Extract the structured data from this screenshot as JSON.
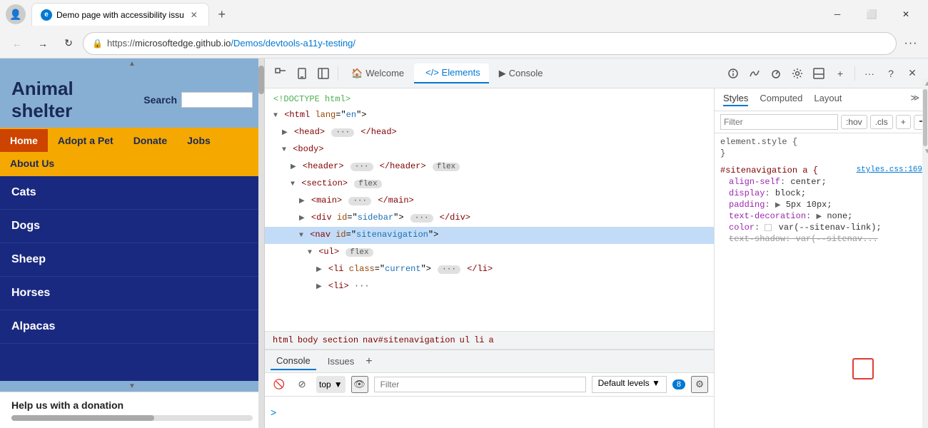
{
  "browser": {
    "tab_title": "Demo page with accessibility issu",
    "url_display": "https://microsoftedge.github.io/Demos/devtools-a11y-testing/",
    "url_scheme": "https://",
    "url_host": "microsoftedge.github.io",
    "url_path": "/Demos/devtools-a11y-testing/"
  },
  "website": {
    "title_line1": "Animal",
    "title_line2": "shelter",
    "search_label": "Search",
    "nav_items": [
      {
        "label": "Home",
        "active": true
      },
      {
        "label": "Adopt a Pet",
        "active": false
      },
      {
        "label": "Donate",
        "active": false
      },
      {
        "label": "Jobs",
        "active": false
      },
      {
        "label": "About Us",
        "active": false
      }
    ],
    "animal_list": [
      "Cats",
      "Dogs",
      "Sheep",
      "Horses",
      "Alpacas"
    ],
    "footer_text": "Help us with a donation"
  },
  "devtools": {
    "toolbar_tabs": [
      {
        "label": "Welcome",
        "icon": "🏠",
        "active": false
      },
      {
        "label": "Elements",
        "icon": "</>",
        "active": true
      },
      {
        "label": "Console",
        "icon": "▷",
        "active": false
      }
    ],
    "html_tree": [
      {
        "text": "<!DOCTYPE html>",
        "indent": 0,
        "type": "comment"
      },
      {
        "text": "<html lang=\"en\">",
        "indent": 0,
        "type": "open"
      },
      {
        "text": "<head> ··· </head>",
        "indent": 1,
        "type": "collapsed"
      },
      {
        "text": "<body>",
        "indent": 1,
        "type": "open"
      },
      {
        "text": "<header> ··· </header>",
        "indent": 2,
        "type": "collapsed",
        "badge": "flex"
      },
      {
        "text": "<section>",
        "indent": 2,
        "type": "open",
        "badge": "flex"
      },
      {
        "text": "<main> ··· </main>",
        "indent": 3,
        "type": "collapsed"
      },
      {
        "text": "<div id=\"sidebar\"> ··· </div>",
        "indent": 3,
        "type": "collapsed"
      },
      {
        "text": "<nav id=\"sitenavigation\">",
        "indent": 3,
        "type": "open"
      },
      {
        "text": "<ul>",
        "indent": 4,
        "type": "open",
        "badge": "flex"
      },
      {
        "text": "<li class=\"current\"> ··· </li>",
        "indent": 5,
        "type": "collapsed"
      },
      {
        "text": "<li> ···",
        "indent": 5,
        "type": "partial"
      }
    ],
    "breadcrumb": [
      "html",
      "body",
      "section",
      "nav#sitenavigation",
      "ul",
      "li",
      "a"
    ],
    "styles_tabs": [
      "Styles",
      "Computed",
      "Layout"
    ],
    "filter_placeholder": "Filter",
    "hov_label": ":hov",
    "cls_label": ".cls",
    "style_rules": [
      {
        "selector": "element.style {",
        "props": []
      },
      {
        "selector": "#sitenavigation a {",
        "link": "styles.css:169",
        "props": [
          {
            "name": "align-self",
            "value": "center;",
            "icon": null
          },
          {
            "name": "display",
            "value": "block;",
            "icon": null
          },
          {
            "name": "padding",
            "value": "▶ 5px 10px;",
            "icon": null
          },
          {
            "name": "text-decoration",
            "value": "▶ none;",
            "icon": null
          },
          {
            "name": "color",
            "value": "□ var(--sitenav-link);",
            "icon": "color"
          },
          {
            "name": "text-shadow",
            "value": "var(--sitenav...",
            "icon": null,
            "partial": true
          }
        ]
      }
    ],
    "console": {
      "tabs": [
        "Console",
        "Issues"
      ],
      "context": "top",
      "filter_placeholder": "Filter",
      "level": "Default levels",
      "badge_count": "8",
      "prompt": ">"
    }
  }
}
